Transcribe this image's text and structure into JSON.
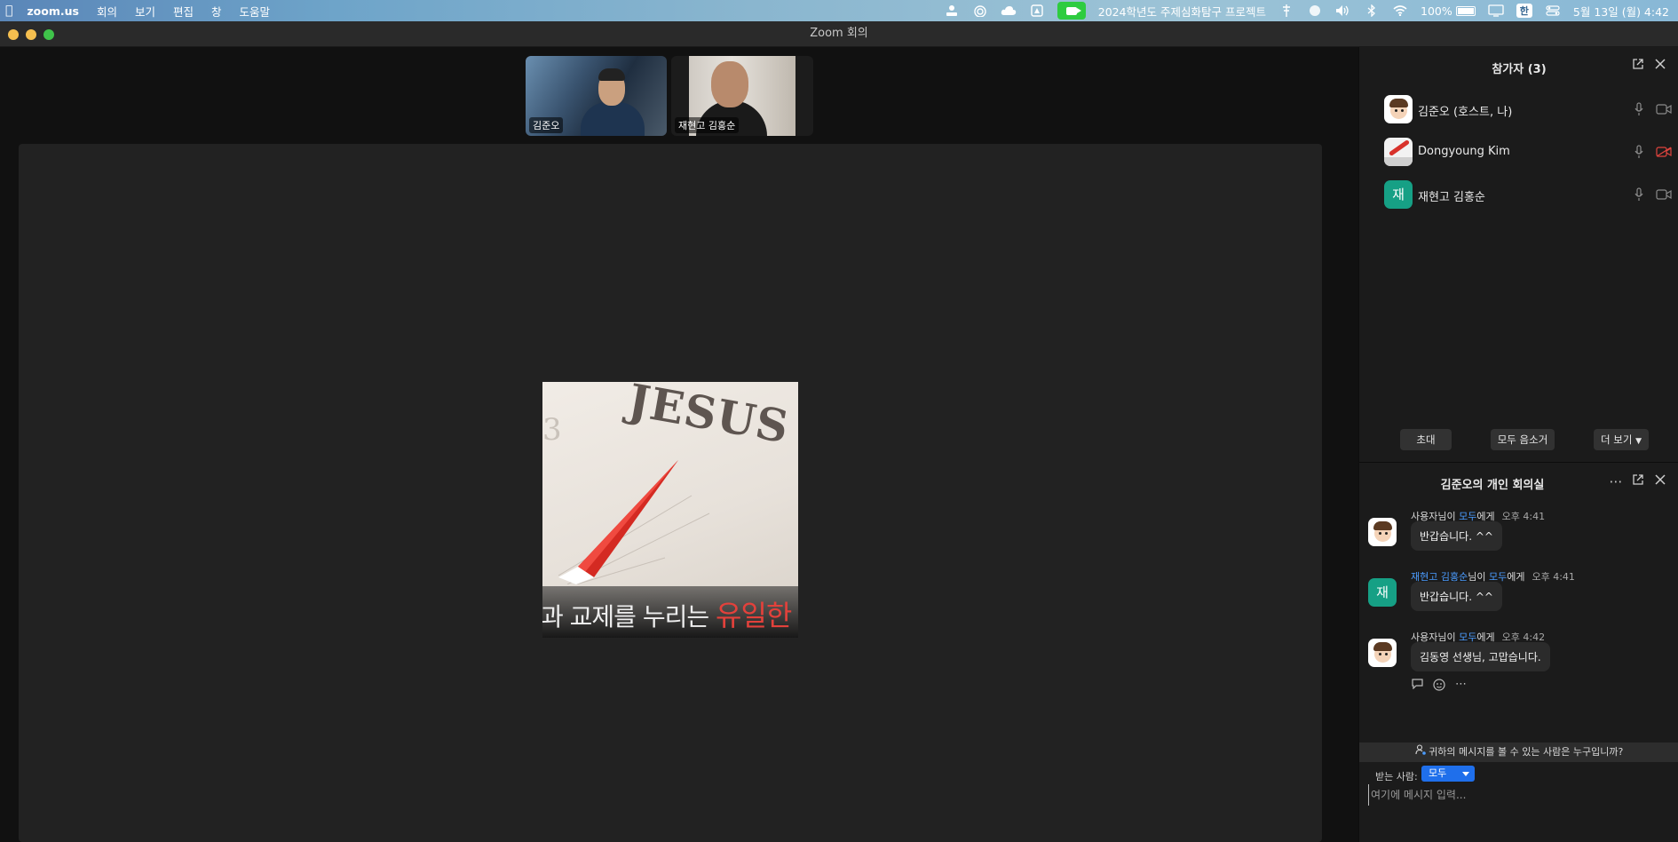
{
  "menubar": {
    "app_name": "zoom.us",
    "menus": [
      "회의",
      "보기",
      "편집",
      "창",
      "도움말"
    ],
    "status_text": "2024학년도 주제심화탐구 프로젝트",
    "battery": "100%",
    "input_method": "한",
    "datetime": "5월 13일 (월) 4:42"
  },
  "window": {
    "title": "Zoom 회의"
  },
  "thumbnails": [
    {
      "name": "김준오"
    },
    {
      "name": "재현고 김홍순"
    }
  ],
  "shared_content": {
    "slide_word": "JESUS",
    "digit": "3",
    "caption_prefix": "과 교제를 누리는 ",
    "caption_highlight": "유일한"
  },
  "participants": {
    "title": "참가자 (3)",
    "list": [
      {
        "name": "김준오 (호스트, 나)",
        "avatar": "cartoon-avatar",
        "video_muted": false
      },
      {
        "name": "Dongyoung Kim",
        "avatar": "photo-avatar",
        "video_muted": true
      },
      {
        "name": "재현고 김홍순",
        "avatar_letter": "재",
        "video_muted": false
      }
    ],
    "buttons": {
      "invite": "초대",
      "mute_all": "모두 음소거",
      "more": "더 보기"
    }
  },
  "chat": {
    "title": "김준오의 개인 회의실",
    "messages": [
      {
        "sender": "사용자",
        "mid": "님이 ",
        "recipient": "모두",
        "suffix": "에게",
        "time": "오후 4:41",
        "text": "반갑습니다. ^^"
      },
      {
        "sender": "재현고 김홍순",
        "mid": "님이 ",
        "recipient": "모두",
        "suffix": "에게",
        "time": "오후 4:41",
        "text": "반갑습니다. ^^",
        "avatar_letter": "재"
      },
      {
        "sender": "사용자",
        "mid": "님이 ",
        "recipient": "모두",
        "suffix": "에게",
        "time": "오후 4:42",
        "text": "김동영 선생님, 고맙습니다."
      }
    ],
    "privacy_notice": "귀하의 메시지를 볼 수 있는 사람은 누구입니까?",
    "to_label": "받는 사람:",
    "to_value": "모두",
    "input_placeholder": "여기에 메시지 입력..."
  },
  "colors": {
    "accent_blue": "#1f6feb",
    "link_blue": "#4b9cff",
    "letter_avatar": "#16a085",
    "video_off_red": "#e0443e",
    "zoom_green": "#2ecc40"
  }
}
